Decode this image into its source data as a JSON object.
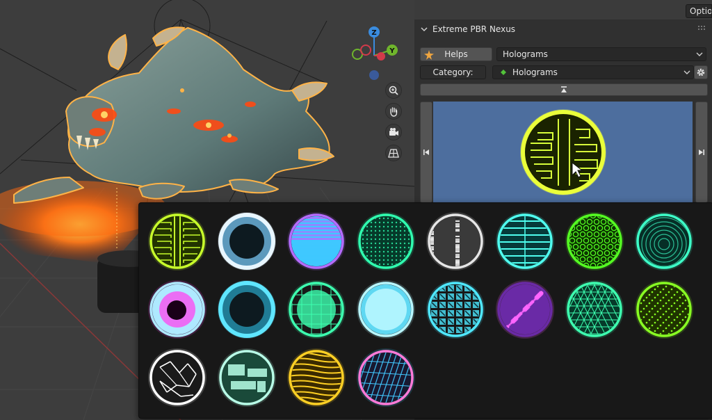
{
  "viewport": {
    "options_label": "Options",
    "gizmo_axes": [
      "Z",
      "Y"
    ]
  },
  "panel": {
    "title": "Extreme PBR Nexus",
    "helps_label": "Helps",
    "library_value": "Holograms",
    "category_label": "Category:",
    "category_value": "Holograms"
  },
  "thumbnails": [
    {
      "name": "circuit-yellow",
      "style": "circuit",
      "colors": [
        "#c8ff2a",
        "#223300"
      ]
    },
    {
      "name": "ring-white",
      "style": "ring",
      "colors": [
        "#e8f6ff",
        "#7fd0ff"
      ]
    },
    {
      "name": "stripes-purple-blue",
      "style": "gradient",
      "colors": [
        "#b46cff",
        "#3fc8ff"
      ]
    },
    {
      "name": "grid-dots-green",
      "style": "dotgrid",
      "colors": [
        "#2fffb0",
        "#063a2a"
      ]
    },
    {
      "name": "map-white-noise",
      "style": "noise",
      "colors": [
        "#e6e6e6",
        "#3a3a3a"
      ]
    },
    {
      "name": "lines-cyan",
      "style": "lines",
      "colors": [
        "#4ffff0",
        "#063a3a"
      ]
    },
    {
      "name": "hex-green",
      "style": "hex",
      "colors": [
        "#55ff22",
        "#0b3300"
      ]
    },
    {
      "name": "waves-teal",
      "style": "rings",
      "colors": [
        "#3dffc8",
        "#062e26"
      ]
    },
    {
      "name": "swirl-pink",
      "style": "swirl",
      "colors": [
        "#ff44f0",
        "#aee9ff"
      ]
    },
    {
      "name": "ring-cyan",
      "style": "ring",
      "colors": [
        "#5fe6ff",
        "#2aa6c8"
      ]
    },
    {
      "name": "net-green",
      "style": "net",
      "colors": [
        "#3dffb0",
        "#1aa070"
      ]
    },
    {
      "name": "cloud-cyan",
      "style": "cloud",
      "colors": [
        "#b8f7ff",
        "#5fd8f2"
      ]
    },
    {
      "name": "crosses-cyan",
      "style": "crosses",
      "colors": [
        "#4fe8ff",
        "#0a2a33"
      ]
    },
    {
      "name": "sparkle-magenta",
      "style": "sparkle",
      "colors": [
        "#ff66ff",
        "#6a2aa6"
      ]
    },
    {
      "name": "triangles-green",
      "style": "tri",
      "colors": [
        "#3dffb0",
        "#063a2a"
      ]
    },
    {
      "name": "sphere-lime-dots",
      "style": "lime",
      "colors": [
        "#88ff22",
        "#1f3300"
      ]
    },
    {
      "name": "cracks-white",
      "style": "cracks",
      "colors": [
        "#ffffff",
        "#d27bff"
      ]
    },
    {
      "name": "blocks-mint",
      "style": "blocks",
      "colors": [
        "#b8ffe8",
        "#1a4a3a"
      ]
    },
    {
      "name": "waves-gold",
      "style": "wavesgold",
      "colors": [
        "#ffd024",
        "#3a2a00"
      ]
    },
    {
      "name": "tech-blue-pink",
      "style": "techblue",
      "colors": [
        "#42c8ff",
        "#ff7ad8"
      ]
    }
  ]
}
